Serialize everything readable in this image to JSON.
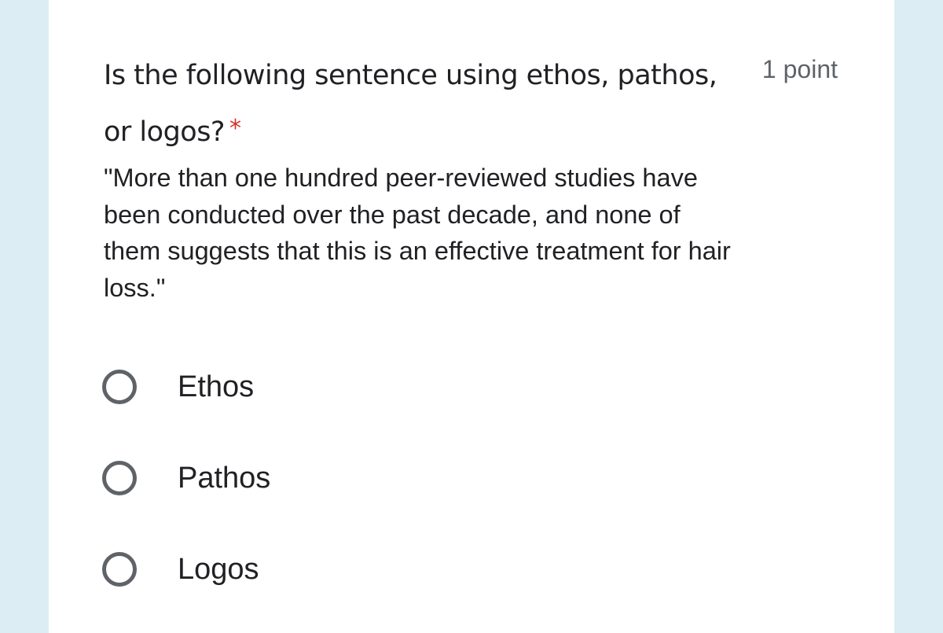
{
  "question": {
    "title": "Is the following sentence using ethos, pathos, or logos?",
    "required_marker": "*",
    "points": "1 point",
    "description": "\"More than one hundred peer-reviewed studies have been conducted over the past decade, and none of them suggests that this is an effective treatment for hair loss.\""
  },
  "options": [
    {
      "label": "Ethos"
    },
    {
      "label": "Pathos"
    },
    {
      "label": "Logos"
    }
  ],
  "colors": {
    "background": "#dcedf3",
    "card": "#ffffff",
    "required": "#d93025",
    "radio_border": "#5f6368"
  }
}
